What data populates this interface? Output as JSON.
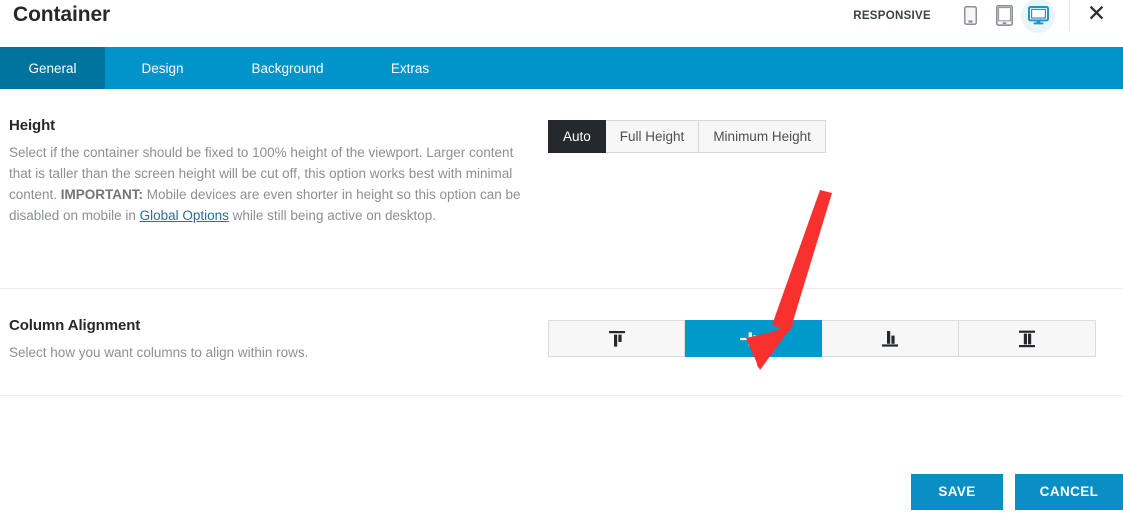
{
  "header": {
    "title": "Container",
    "responsive_label": "RESPONSIVE",
    "devices": [
      {
        "name": "phone-icon",
        "label": "Mobile",
        "active": false
      },
      {
        "name": "tablet-icon",
        "label": "Tablet",
        "active": false
      },
      {
        "name": "desktop-icon",
        "label": "Desktop",
        "active": true
      }
    ],
    "close_label": "✕"
  },
  "tabs": [
    {
      "label": "General",
      "active": true
    },
    {
      "label": "Design",
      "active": false
    },
    {
      "label": "Background",
      "active": false
    },
    {
      "label": "Extras",
      "active": false
    }
  ],
  "height_field": {
    "title": "Height",
    "desc_part1": "Select if the container should be fixed to 100% height of the viewport. Larger content that is taller than the screen height will be cut off, this option works best with minimal content. ",
    "desc_important": "IMPORTANT:",
    "desc_part2": " Mobile devices are even shorter in height so this option can be disabled on mobile in ",
    "desc_link": "Global Options",
    "desc_part3": " while still being active on desktop.",
    "options": [
      {
        "label": "Auto",
        "active": true
      },
      {
        "label": "Full Height",
        "active": false
      },
      {
        "label": "Minimum Height",
        "active": false
      }
    ]
  },
  "alignment_field": {
    "title": "Column Alignment",
    "desc": "Select how you want columns to align within rows.",
    "options": [
      {
        "icon": "align-top-icon",
        "label": "Top",
        "active": false
      },
      {
        "icon": "align-middle-icon",
        "label": "Middle",
        "active": true
      },
      {
        "icon": "align-bottom-icon",
        "label": "Bottom",
        "active": false
      },
      {
        "icon": "align-stretch-icon",
        "label": "Stretch",
        "active": false
      }
    ]
  },
  "footer": {
    "save_label": "SAVE",
    "cancel_label": "CANCEL"
  },
  "colors": {
    "accent": "#0099cc",
    "tabbar": "#0094ca",
    "tab_active": "#00739f",
    "button_active_dark": "#25292e",
    "footer_button": "#0b8ec4",
    "annotation_arrow": "#f8312f"
  }
}
